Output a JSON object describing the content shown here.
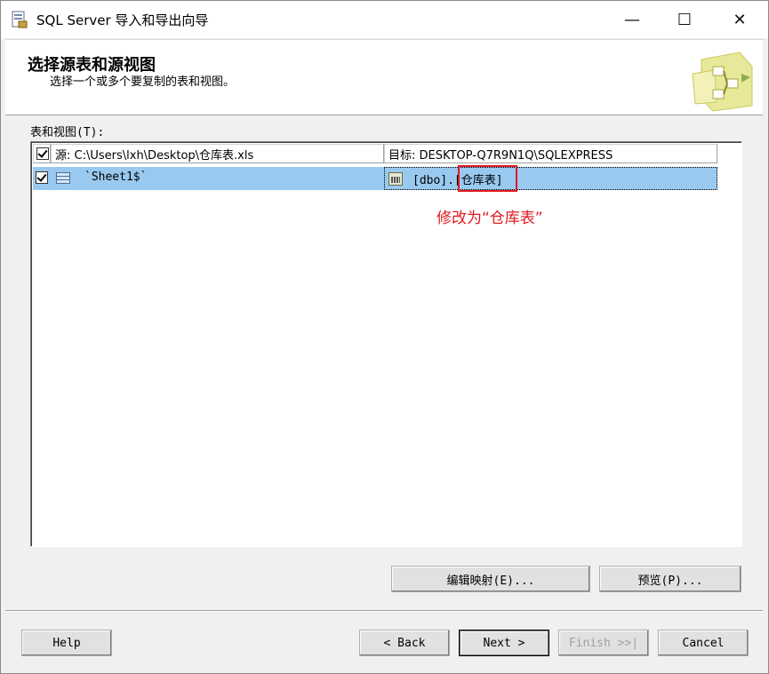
{
  "window": {
    "title": "SQL Server 导入和导出向导",
    "minimize_glyph": "—",
    "maximize_glyph": "☐",
    "close_glyph": "✕"
  },
  "header": {
    "title": "选择源表和源视图",
    "subtitle": "选择一个或多个要复制的表和视图。",
    "graphic_icon": "wizard-graphic-icon"
  },
  "tables_label": "表和视图(T):",
  "grid": {
    "source_header": "源: C:\\Users\\lxh\\Desktop\\仓库表.xls",
    "dest_header": "目标: DESKTOP-Q7R9N1Q\\SQLEXPRESS",
    "rows": [
      {
        "checked": true,
        "source": "`Sheet1$`",
        "dest_schema": "[dbo].",
        "dest_table": "[仓库表]"
      }
    ]
  },
  "annotation": {
    "text": "修改为“仓库表”",
    "color": "#e0191e"
  },
  "buttons": {
    "edit_mappings": "编辑映射(E)...",
    "preview": "预览(P)...",
    "help": "Help",
    "back": "< Back",
    "next": "Next >",
    "finish": "Finish >>|",
    "cancel": "Cancel"
  },
  "colors": {
    "selected_row": "#99c9ef",
    "annotation_red": "#e0191e"
  }
}
